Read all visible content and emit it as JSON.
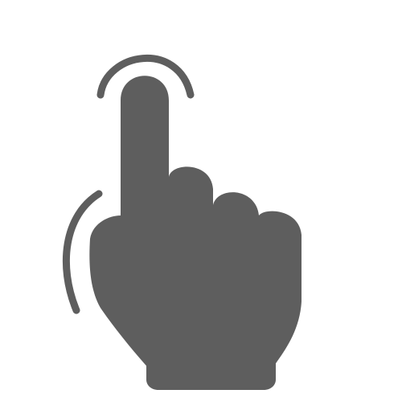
{
  "icon": {
    "name": "tap-gesture-icon",
    "color": "#5e5e5e",
    "background": "#ffffff"
  }
}
